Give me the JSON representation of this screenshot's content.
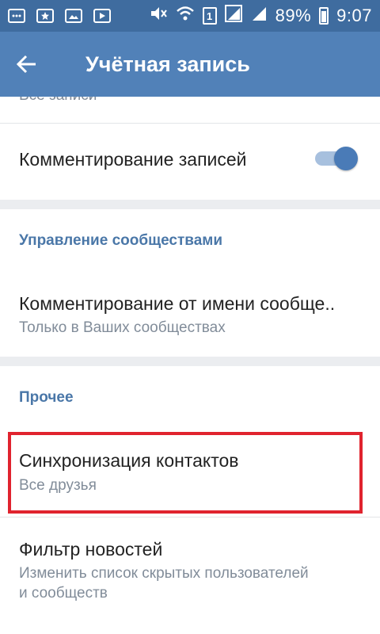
{
  "statusbar": {
    "battery": "89%",
    "time": "9:07",
    "sim": "1"
  },
  "header": {
    "title": "Учётная запись"
  },
  "card1": {
    "partial_text": "Все записи",
    "comment_posts_label": "Комментирование записей",
    "toggle_on": true
  },
  "card2": {
    "section": "Управление сообществами",
    "row_title": "Комментирование от имени сообще..",
    "row_sub": "Только в Ваших сообществах"
  },
  "card3": {
    "section": "Прочее",
    "sync_title": "Синхронизация контактов",
    "sync_sub": "Все друзья",
    "filter_title": "Фильтр новостей",
    "filter_sub_line1": "Изменить список скрытых пользователей",
    "filter_sub_line2": "и сообществ"
  },
  "colors": {
    "header": "#5181b8",
    "statusbar": "#3f6c9f",
    "accent": "#4a77a8",
    "highlight": "#e0232e"
  }
}
